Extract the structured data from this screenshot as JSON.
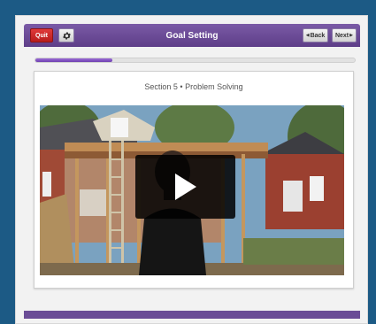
{
  "header": {
    "quit_label": "Quit",
    "title": "Goal Setting",
    "back_label": "Back",
    "next_label": "Next"
  },
  "progress": {
    "fraction": 0.24
  },
  "content": {
    "section_title": "Section 5 • Problem Solving"
  },
  "video": {
    "icon": "play-icon"
  },
  "colors": {
    "header_purple": "#6b4c98",
    "quit_red": "#cc2a2a",
    "progress_fill": "#8450c8",
    "background_blue": "#1c5a85"
  }
}
